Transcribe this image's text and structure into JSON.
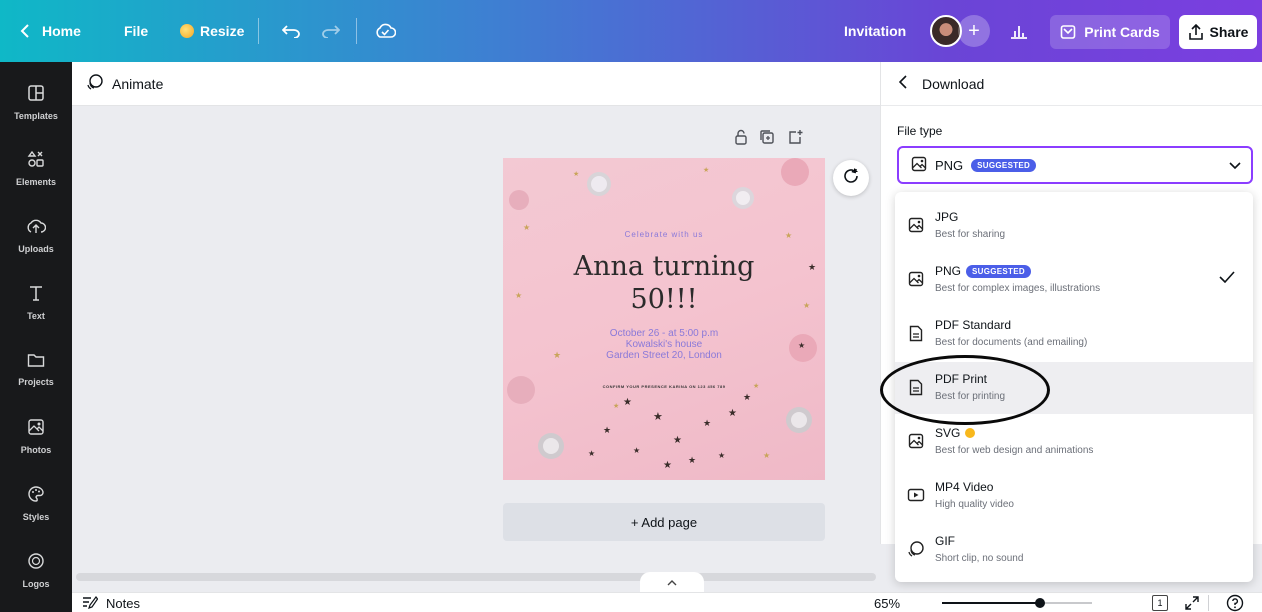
{
  "topbar": {
    "home_label": "Home",
    "file_label": "File",
    "resize_label": "Resize",
    "doc_title": "Invitation",
    "print_label": "Print Cards",
    "share_label": "Share"
  },
  "sidebar": {
    "items": [
      {
        "label": "Templates",
        "icon": "templates-icon"
      },
      {
        "label": "Elements",
        "icon": "elements-icon"
      },
      {
        "label": "Uploads",
        "icon": "uploads-icon"
      },
      {
        "label": "Text",
        "icon": "text-icon"
      },
      {
        "label": "Projects",
        "icon": "folder-icon"
      },
      {
        "label": "Photos",
        "icon": "photos-icon"
      },
      {
        "label": "Styles",
        "icon": "palette-icon"
      },
      {
        "label": "Logos",
        "icon": "logos-icon"
      }
    ]
  },
  "editor": {
    "animate_label": "Animate",
    "add_page_label": "+ Add page"
  },
  "card": {
    "celebrate": "Celebrate with us",
    "headline_line1": "Anna turning",
    "headline_line2": "50!!!",
    "details_line1": "October 26 - at 5:00 p.m",
    "details_line2": "Kowalski's house",
    "details_line3": "Garden Street 20, London",
    "confirm": "CONFIRM YOUR PRESENCE KARINA ON 123 456 789"
  },
  "bottom": {
    "notes_label": "Notes",
    "zoom": "65%",
    "zoom_fraction": 0.65,
    "page_count": "1"
  },
  "download": {
    "title": "Download",
    "file_type_label": "File type",
    "selected": "PNG",
    "suggested_badge": "SUGGESTED",
    "options": [
      {
        "name": "JPG",
        "desc": "Best for sharing",
        "icon": "image-icon"
      },
      {
        "name": "PNG",
        "desc": "Best for complex images, illustrations",
        "icon": "image-icon",
        "badge": "SUGGESTED",
        "checked": true
      },
      {
        "name": "PDF Standard",
        "desc": "Best for documents (and emailing)",
        "icon": "document-icon"
      },
      {
        "name": "PDF Print",
        "desc": "Best for printing",
        "icon": "document-icon"
      },
      {
        "name": "SVG",
        "desc": "Best for web design and animations",
        "icon": "image-icon",
        "pro": true
      },
      {
        "name": "MP4 Video",
        "desc": "High quality video",
        "icon": "video-icon"
      },
      {
        "name": "GIF",
        "desc": "Short clip, no sound",
        "icon": "gif-icon"
      }
    ]
  },
  "colors": {
    "accent": "#8b3dff",
    "badge": "#4b5ee8",
    "sidebar_bg": "#18191b"
  }
}
